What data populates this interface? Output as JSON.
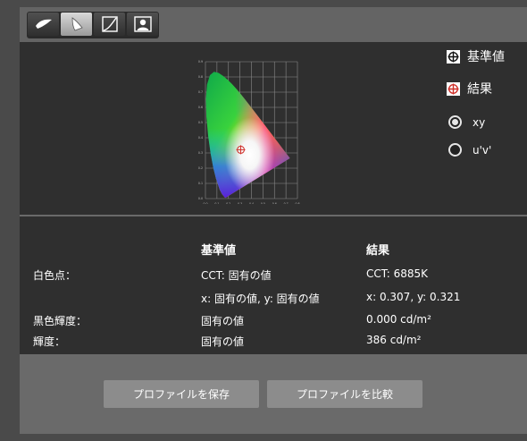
{
  "toolbar": {
    "tools": [
      {
        "icon": "white-point-icon",
        "active": false
      },
      {
        "icon": "gamut-icon",
        "active": true
      },
      {
        "icon": "curve-icon",
        "active": false
      },
      {
        "icon": "portrait-icon",
        "active": false
      }
    ]
  },
  "legend": {
    "reference_label": "基準値",
    "result_label": "結果",
    "reference_marker_icon": "crosshair-icon",
    "result_marker_icon": "crosshair-icon",
    "result_marker_color": "#d0302a"
  },
  "colorspace": {
    "options": [
      {
        "label": "xy",
        "selected": true
      },
      {
        "label": "u'v'",
        "selected": false
      }
    ]
  },
  "table": {
    "header_reference": "基準値",
    "header_result": "結果",
    "row_white_point_label": "白色点：",
    "white_cct_ref": "CCT: 固有の値",
    "white_cct_result": "CCT: 6885K",
    "white_xy_ref": "x: 固有の値, y: 固有の値",
    "white_xy_result": "x: 0.307, y: 0.321",
    "row_black_label": "黒色輝度：",
    "black_ref": "固有の値",
    "black_result": "0.000 cd/m²",
    "row_luminance_label": "輝度：",
    "lum_ref": "固有の値",
    "lum_result": "386 cd/m²"
  },
  "buttons": {
    "save_profile": "プロファイルを保存",
    "compare_profile": "プロファイルを比較"
  },
  "chart_data": {
    "type": "scatter",
    "title": "",
    "xlabel": "",
    "ylabel": "",
    "xlim": [
      0,
      0.8
    ],
    "ylim": [
      0,
      0.9
    ],
    "grid": true,
    "x_ticks": [
      "0.0",
      "0.1",
      "0.2",
      "0.3",
      "0.4",
      "0.5",
      "0.6",
      "0.7",
      "0.8"
    ],
    "y_ticks": [
      "0.0",
      "0.1",
      "0.2",
      "0.3",
      "0.4",
      "0.5",
      "0.6",
      "0.7",
      "0.8",
      "0.9"
    ],
    "series": [
      {
        "points": [
          {
            "x": 0.307,
            "y": 0.321
          }
        ]
      }
    ]
  }
}
